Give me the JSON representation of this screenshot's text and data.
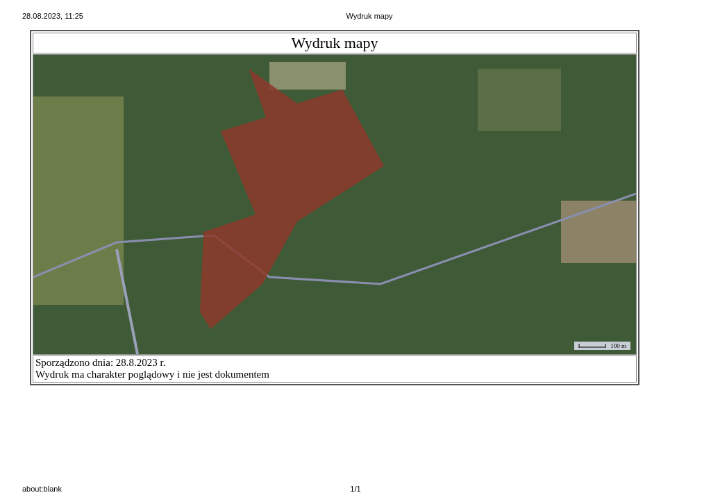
{
  "print_header": {
    "date_time": "28.08.2023, 11:25",
    "title": "Wydruk mapy"
  },
  "document": {
    "title": "Wydruk mapy",
    "map": {
      "scale_label": "100 m"
    },
    "notes": [
      "Sporządzono dnia: 28.8.2023 r.",
      "Wydruk ma charakter poglądowy i nie jest dokumentem"
    ]
  },
  "print_footer": {
    "url": "about:blank",
    "page": "1/1"
  }
}
